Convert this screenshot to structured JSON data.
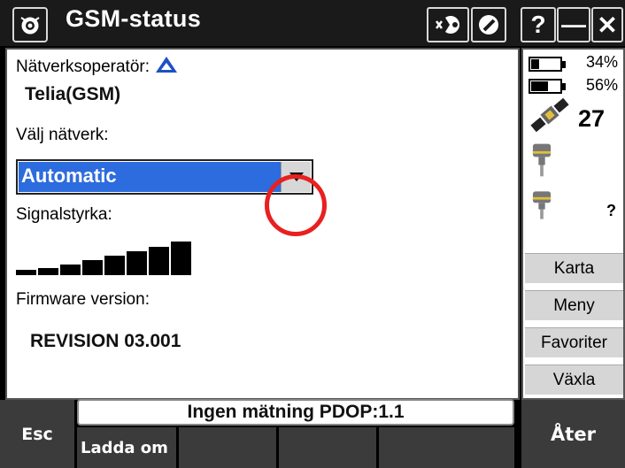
{
  "window": {
    "title": "GSM-status",
    "buttons": {
      "help": "?",
      "minimize": "—",
      "close": "✕"
    }
  },
  "form": {
    "operator_label": "Nätverksoperatör:",
    "operator_value": "Telia(GSM)",
    "network_label": "Välj nätverk:",
    "network_selected": "Automatic",
    "signal_label": "Signalstyrka:",
    "signal_strength_bars": 8,
    "signal_max_bars": 8,
    "firmware_label": "Firmware version:",
    "firmware_value": "REVISION 03.001"
  },
  "status_panel": {
    "battery1_pct": "34%",
    "battery1_level": 0.34,
    "battery2_pct": "56%",
    "battery2_level": 0.56,
    "satellites": "27",
    "receiver2_status": "?"
  },
  "side_buttons": {
    "karta": "Karta",
    "meny": "Meny",
    "favoriter": "Favoriter",
    "vaxla": "Växla"
  },
  "status_bar": {
    "text": "Ingen mätning  PDOP:1.1"
  },
  "softkeys": {
    "esc": "Esc",
    "reload": "Ladda om",
    "back": "Åter"
  },
  "colors": {
    "title_bar": "#1a1a1a",
    "selection": "#2d6cde",
    "annotation_circle": "#e8201f",
    "softkey": "#3b3b3b"
  }
}
